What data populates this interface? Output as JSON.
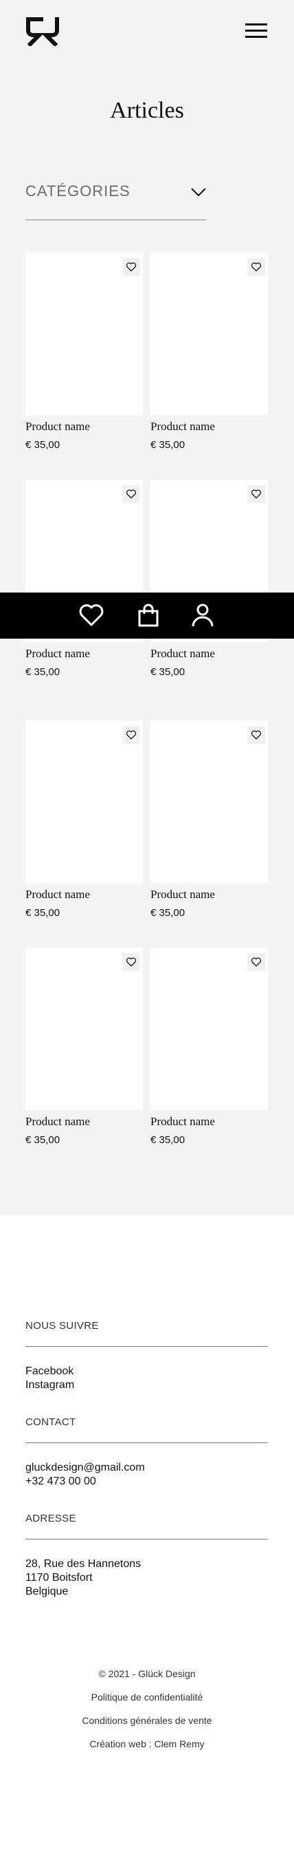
{
  "page": {
    "title": "Articles",
    "categories_label": "CATÉGORIES"
  },
  "products": [
    {
      "name": "Product name",
      "price": "€ 35,00"
    },
    {
      "name": "Product name",
      "price": "€ 35,00"
    },
    {
      "name": "Product name",
      "price": "€ 35,00"
    },
    {
      "name": "Product name",
      "price": "€ 35,00"
    },
    {
      "name": "Product name",
      "price": "€ 35,00"
    },
    {
      "name": "Product name",
      "price": "€ 35,00"
    },
    {
      "name": "Product name",
      "price": "€ 35,00"
    },
    {
      "name": "Product name",
      "price": "€ 35,00"
    }
  ],
  "bottom_bar": {
    "icons": [
      "heart-icon",
      "shopping-bag-icon",
      "user-icon"
    ]
  },
  "footer": {
    "follow_heading": "NOUS SUIVRE",
    "facebook": "Facebook",
    "instagram": "Instagram",
    "contact_heading": "CONTACT",
    "email": "gluckdesign@gmail.com",
    "phone": "+32 473 00 00",
    "address_heading": "ADRESSE",
    "address_line1": "28, Rue des Hannetons",
    "address_line2": "1170 Boitsfort",
    "address_line3": "Belgique",
    "copyright": "© 2021 - Glück Design",
    "privacy": "Politique de confidentialité",
    "terms": "Conditions générales de vente",
    "credit": "Création web : Clem Remy"
  },
  "colors": {
    "background": "#f4f4f4",
    "bar": "#000000",
    "text": "#111111"
  }
}
